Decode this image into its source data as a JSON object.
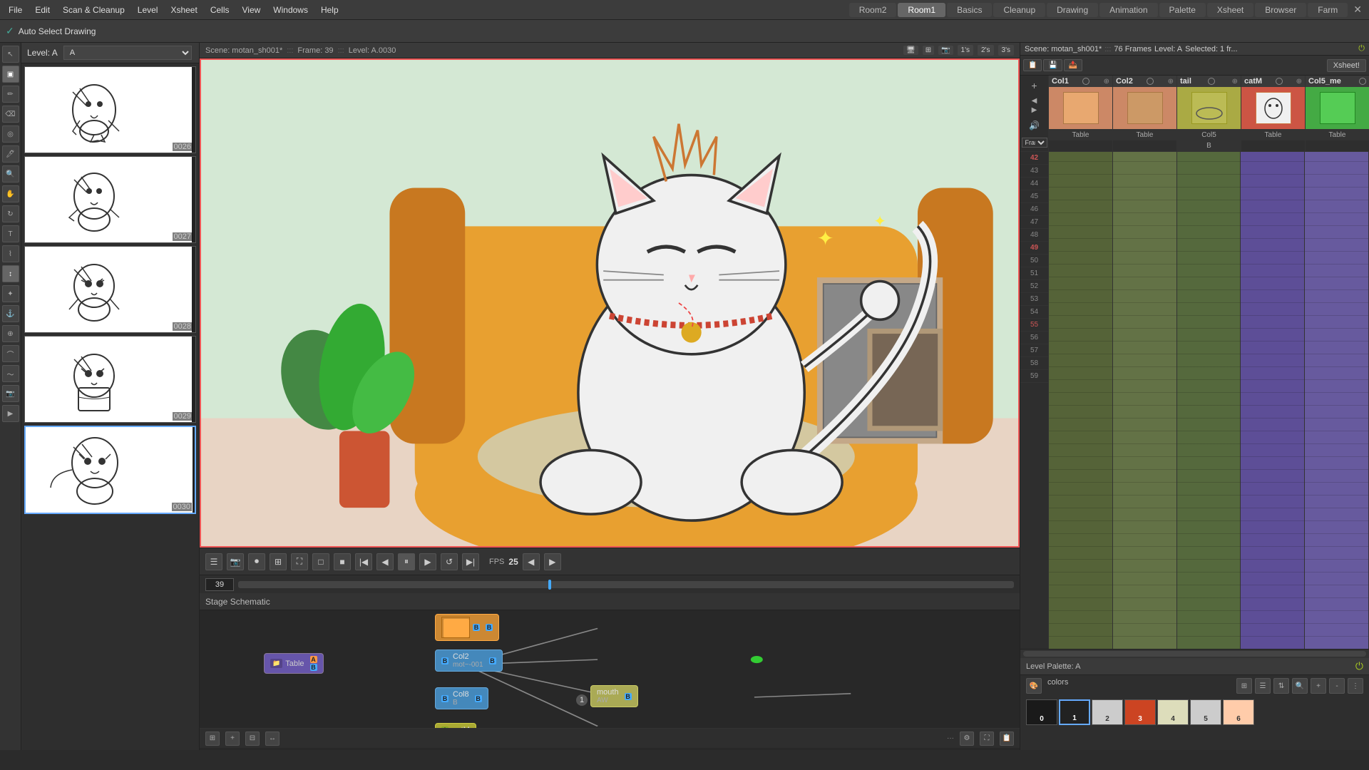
{
  "menubar": {
    "items": [
      "File",
      "Edit",
      "Scan & Cleanup",
      "Level",
      "Xsheet",
      "Cells",
      "View",
      "Windows",
      "Help"
    ]
  },
  "tabs": {
    "items": [
      "Room2",
      "Room1",
      "Basics",
      "Cleanup",
      "Drawing",
      "Animation",
      "Palette",
      "Xsheet",
      "Browser",
      "Farm"
    ],
    "active": "Room1"
  },
  "toolbar": {
    "auto_select": "Auto Select Drawing"
  },
  "level_panel": {
    "header": "Level:  A",
    "dropdown_value": "A",
    "thumbnails": [
      {
        "num": "0026"
      },
      {
        "num": "0027"
      },
      {
        "num": "0028"
      },
      {
        "num": "0029"
      },
      {
        "num": "0030"
      }
    ]
  },
  "scene_header": {
    "scene": "Scene: motan_sh001*",
    "sep1": ":::",
    "frame": "Frame: 39",
    "sep2": ":::",
    "level": "Level: A.0030",
    "playback": [
      "1's",
      "2's",
      "3's"
    ]
  },
  "xsheet_header": {
    "scene": "Scene: motan_sh001*",
    "sep1": ":::",
    "frames": "76 Frames",
    "level": "Level: A",
    "selected": "Selected: 1 fr..."
  },
  "columns": [
    {
      "id": "col1",
      "name": "Col1",
      "label": "Col1",
      "thumb_color": "#cc8866",
      "bottom_label": ""
    },
    {
      "id": "col2",
      "name": "Col2",
      "label": "Col2",
      "thumb_color": "#cc8866",
      "bottom_label": ""
    },
    {
      "id": "tail",
      "name": "tail",
      "label": "tail",
      "thumb_color": "#aaaa44",
      "bottom_label": ""
    },
    {
      "id": "catm",
      "name": "catM",
      "label": "catM",
      "thumb_color": "#cc5544",
      "bottom_label": ""
    },
    {
      "id": "col5me",
      "name": "Col5_me",
      "label": "Col5_me",
      "thumb_color": "#88aa44",
      "bottom_label": ""
    }
  ],
  "column_bottom_labels": {
    "col5": "Col5",
    "b1": "B",
    "table1": "Table",
    "table2": "Table",
    "table3": "Table"
  },
  "row_numbers": [
    42,
    43,
    44,
    45,
    46,
    47,
    48,
    49,
    50,
    51,
    52,
    53,
    54,
    55,
    56,
    57,
    58,
    59
  ],
  "playback": {
    "frame_num": "39",
    "fps_label": "FPS",
    "fps_val": "25"
  },
  "stage_schematic": {
    "title": "Stage Schematic",
    "nodes": {
      "table": "Table",
      "col2_mot": "Col2\nmot~-001",
      "col8_b": "Col8\nB",
      "catm": "catM",
      "mouth_aw": "mouth\nAW",
      "orange": "(orange node)"
    }
  },
  "level_palette": {
    "title": "Level Palette: A",
    "colors_label": "colors",
    "swatches": [
      {
        "num": "0",
        "color": "#1a1a1a"
      },
      {
        "num": "1",
        "color": "#222222"
      },
      {
        "num": "2",
        "color": "#cccccc"
      },
      {
        "num": "3",
        "color": "#cc4422"
      },
      {
        "num": "4",
        "color": "#ddddbb"
      },
      {
        "num": "5",
        "color": "#cccccc"
      },
      {
        "num": "6",
        "color": "#ffccaa"
      }
    ]
  }
}
